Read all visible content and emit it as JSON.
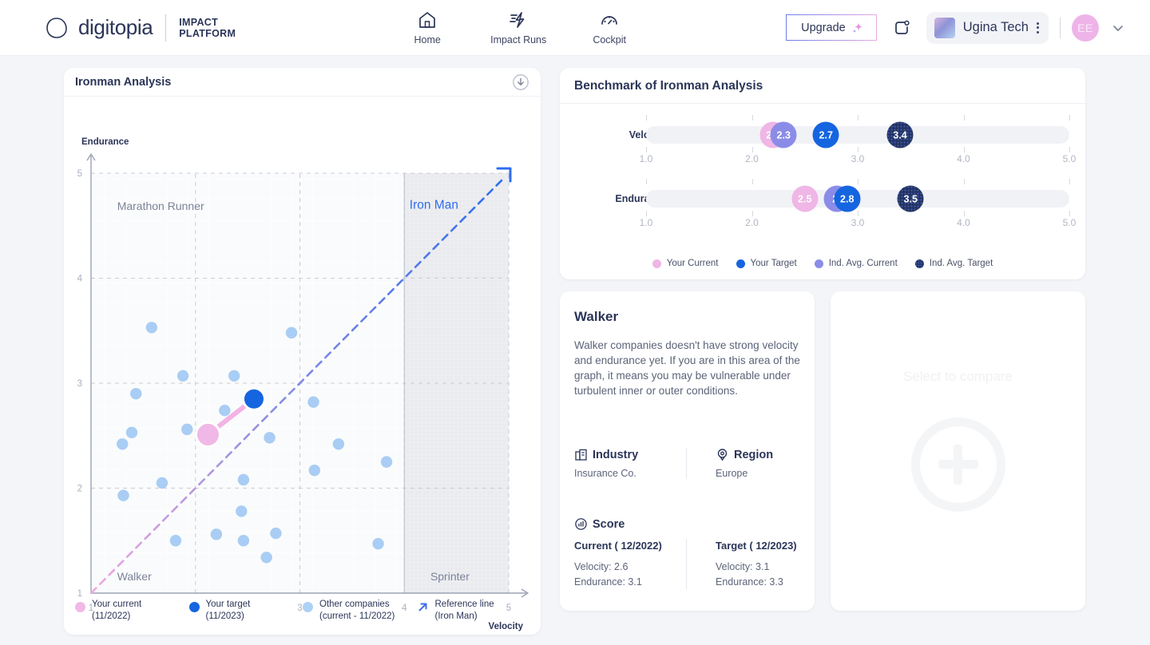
{
  "header": {
    "brand_word": "digitopia",
    "brand_sub_line1": "IMPACT",
    "brand_sub_line2": "PLATFORM",
    "nav": [
      {
        "label": "Home",
        "icon": "home-icon"
      },
      {
        "label": "Impact Runs",
        "icon": "lightning-icon"
      },
      {
        "label": "Cockpit",
        "icon": "gauge-icon"
      }
    ],
    "upgrade_label": "Upgrade",
    "org_name": "Ugina Tech",
    "avatar_initials": "EE"
  },
  "left_panel": {
    "title": "Ironman Analysis",
    "download_icon": "download-circle-icon"
  },
  "chart_data": {
    "type": "scatter",
    "title": "Ironman Analysis",
    "xlabel": "Velocity",
    "ylabel": "Endurance",
    "xlim": [
      1,
      5
    ],
    "ylim": [
      1,
      5
    ],
    "xticks": [
      1,
      2,
      3,
      4,
      5
    ],
    "yticks": [
      1,
      2,
      3,
      4,
      5
    ],
    "grid": true,
    "quadrant_labels": [
      {
        "text": "Marathon Runner",
        "x": 1.25,
        "y": 4.65
      },
      {
        "text": "Iron Man",
        "x": 4.05,
        "y": 4.66
      },
      {
        "text": "Walker",
        "x": 1.25,
        "y": 1.12
      },
      {
        "text": "Sprinter",
        "x": 4.25,
        "y": 1.12
      }
    ],
    "reference_line": {
      "label": "Reference line (Iron Man)",
      "from": [
        1,
        1
      ],
      "to": [
        5,
        5
      ]
    },
    "series": [
      {
        "name": "Other companies (current - 11/2022)",
        "color": "#a9cdf4",
        "points": [
          [
            1.58,
            3.53
          ],
          [
            2.92,
            3.48
          ],
          [
            1.88,
            3.07
          ],
          [
            2.37,
            3.07
          ],
          [
            1.43,
            2.9
          ],
          [
            3.13,
            2.82
          ],
          [
            2.28,
            2.74
          ],
          [
            1.92,
            2.56
          ],
          [
            1.39,
            2.53
          ],
          [
            1.3,
            2.42
          ],
          [
            2.71,
            2.48
          ],
          [
            3.37,
            2.42
          ],
          [
            3.83,
            2.25
          ],
          [
            3.14,
            2.17
          ],
          [
            1.68,
            2.05
          ],
          [
            2.46,
            2.08
          ],
          [
            1.31,
            1.93
          ],
          [
            2.44,
            1.78
          ],
          [
            2.2,
            1.56
          ],
          [
            2.77,
            1.57
          ],
          [
            1.81,
            1.5
          ],
          [
            2.46,
            1.5
          ],
          [
            3.75,
            1.47
          ],
          [
            2.68,
            1.34
          ]
        ]
      },
      {
        "name": "Your current (11/2022)",
        "color": "#f0b8e6",
        "points": [
          [
            2.12,
            2.51
          ]
        ]
      },
      {
        "name": "Your target (11/2023)",
        "color": "#1565e0",
        "points": [
          [
            2.56,
            2.85
          ]
        ]
      }
    ],
    "legend": [
      {
        "label_line1": "Your current",
        "label_line2": "(11/2022)",
        "color": "#f0b8e6",
        "icon": "dot-icon"
      },
      {
        "label_line1": "Your target",
        "label_line2": "(11/2023)",
        "color": "#1565e0",
        "icon": "dot-icon"
      },
      {
        "label_line1": "Other companies",
        "label_line2": "(current - 11/2022)",
        "color": "#aed2f6",
        "icon": "dot-icon"
      },
      {
        "label_line1": "Reference line",
        "label_line2": "(Iron Man)",
        "color": "#3f6fe6",
        "icon": "arrow-up-right-icon"
      }
    ]
  },
  "benchmark": {
    "title": "Benchmark of Ironman Analysis",
    "scale_min": 1.0,
    "scale_max": 5.0,
    "scale_ticks": [
      "1.0",
      "2.0",
      "3.0",
      "4.0",
      "5.0"
    ],
    "rows": [
      {
        "name": "Velocity",
        "markers": [
          {
            "series": "Your Current",
            "value": 2.2,
            "label": "2.2",
            "color": "#efb6e6"
          },
          {
            "series": "Ind. Avg. Current",
            "value": 2.3,
            "label": "2.3",
            "color": "#8b8ce8"
          },
          {
            "series": "Your Target",
            "value": 2.7,
            "label": "2.7",
            "color": "#1565e0"
          },
          {
            "series": "Ind. Avg. Target",
            "value": 3.4,
            "label": "3.4",
            "color": "#22315f"
          }
        ]
      },
      {
        "name": "Endurance",
        "markers": [
          {
            "series": "Your Current",
            "value": 2.5,
            "label": "2.5",
            "color": "#efb6e6"
          },
          {
            "series": "Ind. Avg. Current",
            "value": 2.8,
            "label": "2.",
            "color": "#8b8ce8"
          },
          {
            "series": "Your Target",
            "value": 2.9,
            "label": "2.8",
            "color": "#1565e0"
          },
          {
            "series": "Ind. Avg. Target",
            "value": 3.5,
            "label": "3.5",
            "color": "#22315f"
          }
        ]
      }
    ],
    "legend": [
      {
        "label": "Your Current",
        "color": "#efb6e6"
      },
      {
        "label": "Your Target",
        "color": "#1565e0"
      },
      {
        "label": "Ind. Avg. Current",
        "color": "#8b8ce8"
      },
      {
        "label": "Ind. Avg. Target",
        "color": "#22315f"
      }
    ]
  },
  "info_card": {
    "title": "Walker",
    "description": "Walker companies doesn't have strong velocity and endurance yet. If you are in this area of the graph, it means you may be vulnerable under turbulent inner or outer conditions.",
    "industry_label": "Industry",
    "industry_value": "Insurance Co.",
    "region_label": "Region",
    "region_value": "Europe",
    "score_label": "Score",
    "current_header": "Current ( 12/2022)",
    "current_velocity": "Velocity: 2.6",
    "current_endurance": "Endurance: 3.1",
    "target_header": "Target ( 12/2023)",
    "target_velocity": "Velocity: 3.1",
    "target_endurance": "Endurance: 3.3"
  },
  "compare_card": {
    "placeholder": "Select to compare",
    "icon": "plus-circle-icon"
  }
}
